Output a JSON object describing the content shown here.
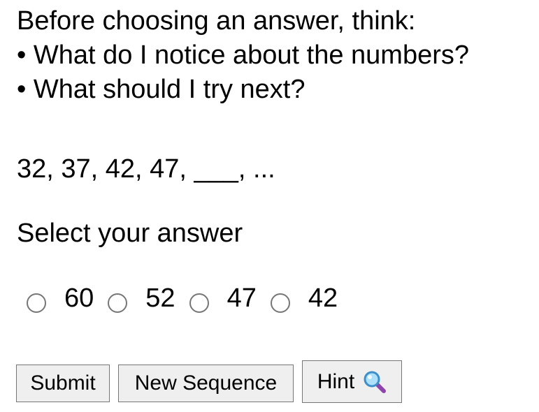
{
  "prompt": {
    "heading": "Before choosing an answer, think:",
    "bullets": [
      "• What do I notice about the numbers?",
      "• What should I try next?"
    ]
  },
  "sequence": {
    "text": "32, 37, 42, 47, ___, ..."
  },
  "question": {
    "select_label": "Select your answer"
  },
  "options": [
    {
      "label": "60",
      "selected": false
    },
    {
      "label": "52",
      "selected": false
    },
    {
      "label": "47",
      "selected": false
    },
    {
      "label": "42",
      "selected": false
    }
  ],
  "buttons": {
    "submit_label": "Submit",
    "new_sequence_label": "New Sequence",
    "hint_label": "Hint",
    "hint_icon": "magnifying-glass-icon"
  },
  "colors": {
    "button_bg": "#efefef",
    "button_border": "#767676",
    "radio_border": "#767676",
    "icon_lens": "#4aa3df",
    "icon_handle": "#8e44ad"
  }
}
